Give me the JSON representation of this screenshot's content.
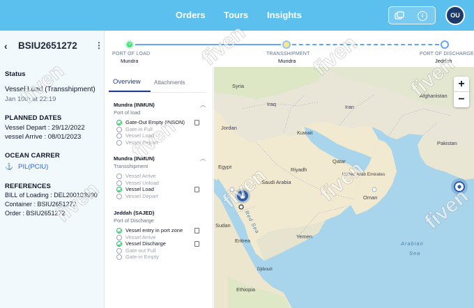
{
  "nav": {
    "orders": "Orders",
    "tours": "Tours",
    "insights": "Insights"
  },
  "toolbar": {
    "info_glyph": "i",
    "chat_icon": "chat-icon",
    "info_icon": "info-icon"
  },
  "user": {
    "initials": "OU"
  },
  "detail": {
    "back_glyph": "‹",
    "container_id": "BSIU2651272",
    "menu_glyph": "⋮",
    "status_label": "Status",
    "status_value": "Vessel Load (Transshipment)",
    "status_time": "Jan 10th at 22:19",
    "planned_dates_label": "PLANNED DATES",
    "vessel_depart": "Vessel Depart : 29/12/2022",
    "vessel_arrive": "vessel Arrive : 08/01/2023",
    "ocean_carrier_label": "OCEAN CARRER",
    "carrier": "PIL(PCIU)",
    "references_label": "REFERENCES",
    "bill_of_loading": "BILL of Loading : DEL200103900",
    "container": "Container : BSIU2651272",
    "order": "Order : BSIU2651272"
  },
  "route": {
    "steps": [
      {
        "label": "PORT OF LOAD",
        "place": "Mundra",
        "state": "done"
      },
      {
        "label": "TRANSSHIPMENT",
        "place": "Mundra",
        "state": "current"
      },
      {
        "label": "PORT OF DISCHARGE",
        "place": "Jeddah",
        "state": "pending"
      }
    ],
    "check_glyph": "✓"
  },
  "tabs": {
    "overview": "Overview",
    "attachments": "Attachments"
  },
  "timeline": {
    "chevron_glyph": "︿",
    "sections": [
      {
        "title": "Mundra (INMUN)",
        "subtitle": "Port of load",
        "events": [
          {
            "text": "Gate-Out Empty (INSON)",
            "done": true,
            "doc": true
          },
          {
            "text": "Gate-in Full",
            "done": false
          },
          {
            "text": "Vessel Load",
            "done": false
          },
          {
            "text": "Vessel Depart",
            "done": false
          }
        ]
      },
      {
        "title": "Mundra (INMUN)",
        "subtitle": "Transshipment",
        "events": [
          {
            "text": "Vessel Arrive",
            "done": false
          },
          {
            "text": "Vessel Unload",
            "done": false
          },
          {
            "text": "Vessel Load",
            "done": true,
            "doc": true
          },
          {
            "text": "Vessel Depart",
            "done": false
          }
        ]
      },
      {
        "title": "Jeddah (SAJED)",
        "subtitle": "Port of Discharge",
        "events": [
          {
            "text": "Vessel entry  in port zone",
            "done": true,
            "doc": true
          },
          {
            "text": "Vessel Arrive",
            "done": false
          },
          {
            "text": "Vessel Discharge",
            "done": true,
            "doc": true
          },
          {
            "text": "Gate-out Full",
            "done": false
          },
          {
            "text": "Gate-in Empty",
            "done": false
          }
        ]
      }
    ]
  },
  "map": {
    "zoom_in": "+",
    "zoom_out": "−",
    "labels": {
      "syria": "Syria",
      "iraq": "Iraq",
      "iran": "Iran",
      "afghanistan": "Afghanistan",
      "kuwait": "Kuwait",
      "jordan": "Jordan",
      "egypt": "Egypt",
      "saudi_arabia": "Saudi Arabia",
      "riyadh": "Riyadh",
      "qatar": "Qatar",
      "uae": "United Arab Emirates",
      "oman": "Oman",
      "pakistan": "Pakistan",
      "yemen": "Yemen",
      "eritrea": "Eritrea",
      "sudan": "Sudan",
      "ethiopia": "Ethiopia",
      "djibouti": "Djibouti",
      "arabian_sea_1": "Arabian",
      "arabian_sea_2": "Sea",
      "red_sea": "Red Sea"
    },
    "colors": {
      "water": "#a8d5ec",
      "land": "#eceadf",
      "desert": "#f2ecd4",
      "green": "#dfe9c9",
      "marker": "#2a5ea8"
    }
  },
  "watermark": "fiven"
}
